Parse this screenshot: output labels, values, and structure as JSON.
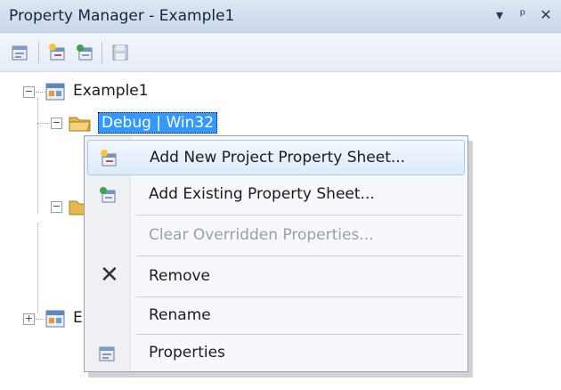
{
  "window": {
    "title": "Property Manager - Example1",
    "controls": [
      "▾",
      "ᵖ",
      "✕"
    ]
  },
  "toolbar": {
    "buttons": [
      {
        "icon": "property-sheet-icon"
      },
      {
        "icon": "add-new-sheet-icon"
      },
      {
        "icon": "add-existing-sheet-icon"
      },
      {
        "icon": "save-icon"
      }
    ]
  },
  "tree": {
    "root": {
      "label": "Example1",
      "expander": "−"
    },
    "child_selected": {
      "label": "Debug | Win32",
      "expander": "−"
    },
    "collapsed_child": {
      "expander": "−"
    },
    "second_root": {
      "label": "E",
      "expander": "+"
    }
  },
  "context_menu": {
    "items": [
      {
        "label": "Add New Project Property Sheet...",
        "icon": "add-new-sheet-icon",
        "enabled": true,
        "highlighted": true
      },
      {
        "label": "Add Existing Property Sheet...",
        "icon": "add-existing-sheet-icon",
        "enabled": true
      },
      {
        "label": "Clear Overridden Properties...",
        "icon": "",
        "enabled": false
      },
      {
        "label": "Remove",
        "icon": "remove-x-icon",
        "enabled": true
      },
      {
        "label": "Rename",
        "icon": "",
        "enabled": true
      },
      {
        "label": "Properties",
        "icon": "properties-icon",
        "enabled": true
      }
    ]
  },
  "colors": {
    "selection": "#3399ff",
    "menu_hover_border": "#a9c8ea",
    "disabled_text": "#9aa0a8"
  }
}
